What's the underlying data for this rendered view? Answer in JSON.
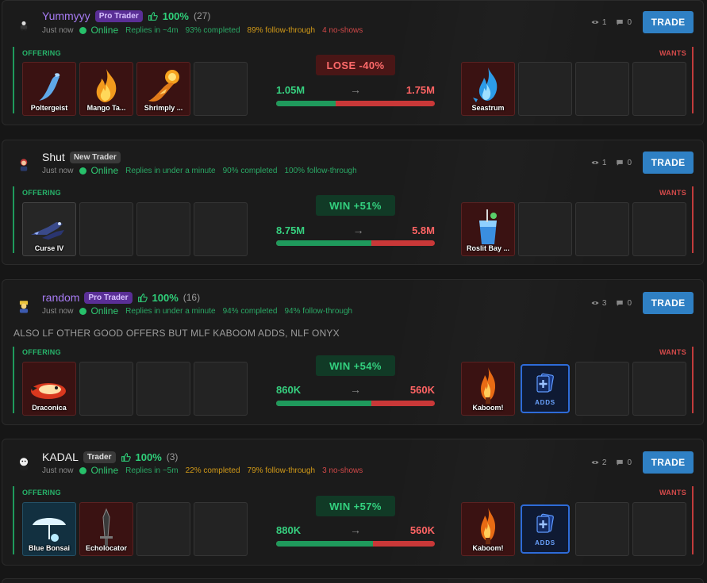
{
  "trades": [
    {
      "username": "Yummyyy",
      "name_color": "purple",
      "badge": "Pro Trader",
      "badge_type": "pro",
      "rating": "100%",
      "rating_count": "(27)",
      "ago": "Just now",
      "status": "Online",
      "meta": [
        {
          "text": "Replies in ~4m",
          "tone": "green"
        },
        {
          "text": "93% completed",
          "tone": "green"
        },
        {
          "text": "89% follow-through",
          "tone": "amber"
        },
        {
          "text": "4 no-shows",
          "tone": "red"
        }
      ],
      "views": "1",
      "comments": "0",
      "trade_label": "TRADE",
      "note": "",
      "offering_label": "OFFERING",
      "wants_label": "WANTS",
      "verdict": "LOSE -40%",
      "verdict_type": "lose",
      "offer_value": "1.05M",
      "want_value": "1.75M",
      "arrow": "→",
      "bar_ratio": 0.375,
      "offer_items": [
        {
          "name": "Poltergeist",
          "icon": "blue-ghost-icon"
        },
        {
          "name": "Mango Ta...",
          "icon": "fire-flame-icon"
        },
        {
          "name": "Shrimply ...",
          "icon": "flame-swirl-icon"
        }
      ],
      "want_items": [
        {
          "name": "Seastrum",
          "icon": "blue-flame-icon"
        }
      ]
    },
    {
      "username": "Shut",
      "name_color": "white",
      "badge": "New Trader",
      "badge_type": "new",
      "rating": "",
      "rating_count": "",
      "ago": "Just now",
      "status": "Online",
      "meta": [
        {
          "text": "Replies in under a minute",
          "tone": "green"
        },
        {
          "text": "90% completed",
          "tone": "green"
        },
        {
          "text": "100% follow-through",
          "tone": "green"
        }
      ],
      "views": "1",
      "comments": "0",
      "trade_label": "TRADE",
      "note": "",
      "offering_label": "OFFERING",
      "wants_label": "WANTS",
      "verdict": "WIN +51%",
      "verdict_type": "win",
      "offer_value": "8.75M",
      "want_value": "5.8M",
      "arrow": "→",
      "bar_ratio": 0.6,
      "offer_items": [
        {
          "name": "Curse IV",
          "icon": "dark-jets-icon"
        }
      ],
      "want_items": [
        {
          "name": "Roslit Bay ...",
          "icon": "blue-drink-icon"
        }
      ]
    },
    {
      "username": "random",
      "name_color": "purple",
      "badge": "Pro Trader",
      "badge_type": "pro",
      "rating": "100%",
      "rating_count": "(16)",
      "ago": "Just now",
      "status": "Online",
      "meta": [
        {
          "text": "Replies in under a minute",
          "tone": "green"
        },
        {
          "text": "94% completed",
          "tone": "green"
        },
        {
          "text": "94% follow-through",
          "tone": "green"
        }
      ],
      "views": "3",
      "comments": "0",
      "trade_label": "TRADE",
      "note": "ALSO LF OTHER GOOD OFFERS BUT MLF KABOOM ADDS, NLF ONYX",
      "offering_label": "OFFERING",
      "wants_label": "WANTS",
      "verdict": "WIN +54%",
      "verdict_type": "win",
      "offer_value": "860K",
      "want_value": "560K",
      "arrow": "→",
      "bar_ratio": 0.6,
      "offer_items": [
        {
          "name": "Draconica",
          "icon": "dragon-fire-icon"
        }
      ],
      "want_items": [
        {
          "name": "Kaboom!",
          "icon": "orange-flame-icon"
        },
        {
          "name": "ADDS",
          "icon": "adds-cards-icon",
          "adds": true
        }
      ]
    },
    {
      "username": "KADAL",
      "name_color": "white",
      "badge": "Trader",
      "badge_type": "trader",
      "rating": "100%",
      "rating_count": "(3)",
      "ago": "Just now",
      "status": "Online",
      "meta": [
        {
          "text": "Replies in ~5m",
          "tone": "green"
        },
        {
          "text": "22% completed",
          "tone": "amber"
        },
        {
          "text": "79% follow-through",
          "tone": "amber"
        },
        {
          "text": "3 no-shows",
          "tone": "red"
        }
      ],
      "views": "2",
      "comments": "0",
      "trade_label": "TRADE",
      "note": "",
      "offering_label": "OFFERING",
      "wants_label": "WANTS",
      "verdict": "WIN +57%",
      "verdict_type": "win",
      "offer_value": "880K",
      "want_value": "560K",
      "arrow": "→",
      "bar_ratio": 0.61,
      "offer_items": [
        {
          "name": "Blue Bonsai",
          "icon": "blue-umbrella-icon"
        },
        {
          "name": "Echolocator",
          "icon": "dark-blade-icon"
        }
      ],
      "want_items": [
        {
          "name": "Kaboom!",
          "icon": "orange-flame-icon"
        },
        {
          "name": "ADDS",
          "icon": "adds-cards-icon",
          "adds": true
        }
      ]
    }
  ]
}
